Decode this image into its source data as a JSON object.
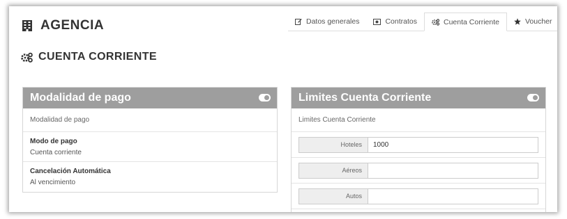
{
  "header": {
    "title": "AGENCIA",
    "icon": "building-icon"
  },
  "tabs": [
    {
      "label": "Datos generales",
      "icon": "edit-icon"
    },
    {
      "label": "Contratos",
      "icon": "money-icon"
    },
    {
      "label": "Cuenta Corriente",
      "icon": "cogs-icon",
      "active": true
    },
    {
      "label": "Voucher",
      "icon": "star-icon"
    }
  ],
  "section": {
    "title": "CUENTA CORRIENTE",
    "icon": "cogs-icon"
  },
  "payment_panel": {
    "title": "Modalidad de pago",
    "subtitle": "Modalidad de pago",
    "fields": [
      {
        "label": "Modo de pago",
        "value": "Cuenta corriente"
      },
      {
        "label": "Cancelación Automática",
        "value": "Al vencimiento"
      }
    ]
  },
  "limits_panel": {
    "title": "Limites Cuenta Corriente",
    "subtitle": "Limites Cuenta Corriente",
    "rows": [
      {
        "label": "Hoteles",
        "value": "1000"
      },
      {
        "label": "Aéreos",
        "value": ""
      },
      {
        "label": "Autos",
        "value": ""
      }
    ]
  },
  "colors": {
    "panel_header": "#9e9e9e",
    "border": "#d6d6d6"
  }
}
